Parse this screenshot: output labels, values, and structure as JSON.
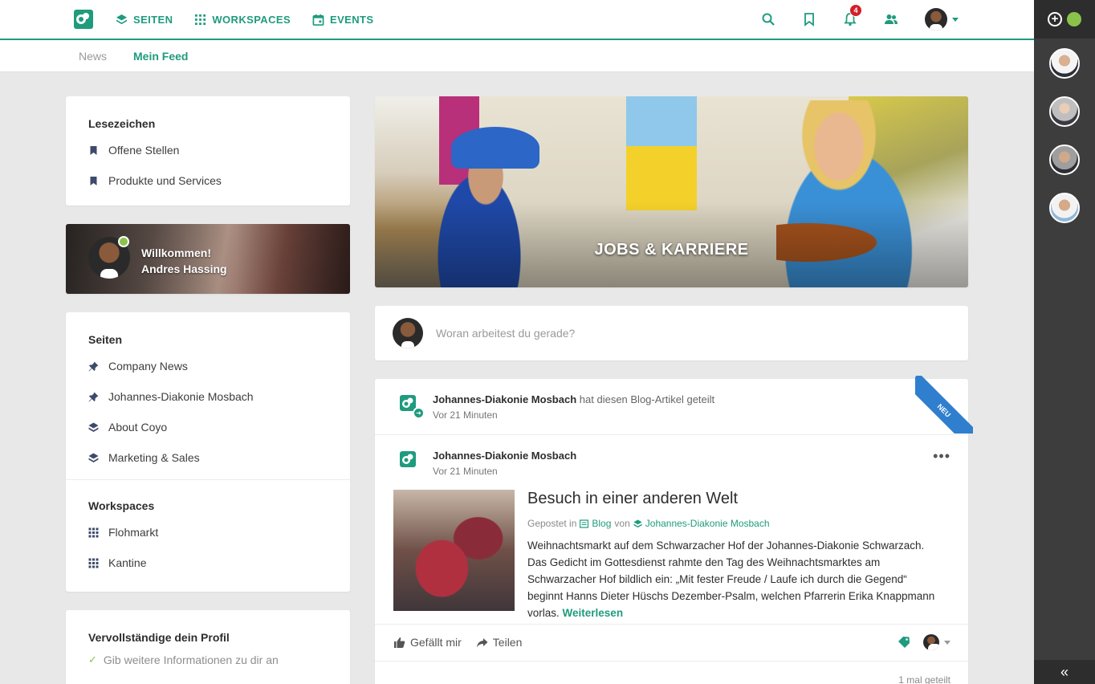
{
  "nav": {
    "items": [
      {
        "label": "SEITEN",
        "icon": "layers-icon"
      },
      {
        "label": "WORKSPACES",
        "icon": "grid-icon"
      },
      {
        "label": "EVENTS",
        "icon": "calendar-icon"
      }
    ],
    "notification_count": "4",
    "icons": [
      "search-icon",
      "bookmark-icon",
      "bell-icon",
      "people-icon"
    ]
  },
  "subtabs": [
    {
      "label": "News",
      "active": false
    },
    {
      "label": "Mein Feed",
      "active": true
    }
  ],
  "bookmarks": {
    "title": "Lesezeichen",
    "items": [
      "Offene Stellen",
      "Produkte und Services"
    ]
  },
  "welcome": {
    "greeting": "Willkommen!",
    "name": "Andres Hassing"
  },
  "pages": {
    "title": "Seiten",
    "items": [
      "Company News",
      "Johannes-Diakonie Mosbach",
      "About Coyo",
      "Marketing & Sales"
    ],
    "workspaces_title": "Workspaces",
    "workspaces": [
      "Flohmarkt",
      "Kantine"
    ]
  },
  "profile": {
    "title": "Vervollständige dein Profil",
    "step": "Gib weitere Informationen zu dir an"
  },
  "hero": {
    "title": "JOBS & KARRIERE"
  },
  "composer": {
    "placeholder": "Woran arbeitest du gerade?"
  },
  "post": {
    "ribbon": "NEU",
    "share_author": "Johannes-Diakonie Mosbach",
    "share_action": "hat diesen Blog-Artikel geteilt",
    "share_time": "Vor 21 Minuten",
    "author": "Johannes-Diakonie Mosbach",
    "time": "Vor 21 Minuten",
    "title": "Besuch in einer anderen Welt",
    "posted_in_label": "Gepostet in",
    "posted_in": "Blog",
    "by_label": "von",
    "by": "Johannes-Diakonie Mosbach",
    "excerpt": "Weihnachtsmarkt auf dem Schwarzacher Hof der Johannes-Diakonie Schwarzach. Das Gedicht im Gottesdienst rahmte den Tag des Weihnachtsmarktes am Schwarzacher Hof bildlich ein: „Mit fester Freude / Laufe ich durch die Gegend“ beginnt Hanns Dieter Hüschs Dezember-Psalm, welchen Pfarrerin Erika Knappmann vorlas.",
    "read_more": "Weiterlesen",
    "like": "Gefällt mir",
    "share": "Teilen",
    "shared_count": "1 mal geteilt"
  },
  "colors": {
    "accent": "#1f9b7e",
    "ribbon": "#2f7fce",
    "badge": "#d0202a",
    "online": "#8bc34a"
  }
}
